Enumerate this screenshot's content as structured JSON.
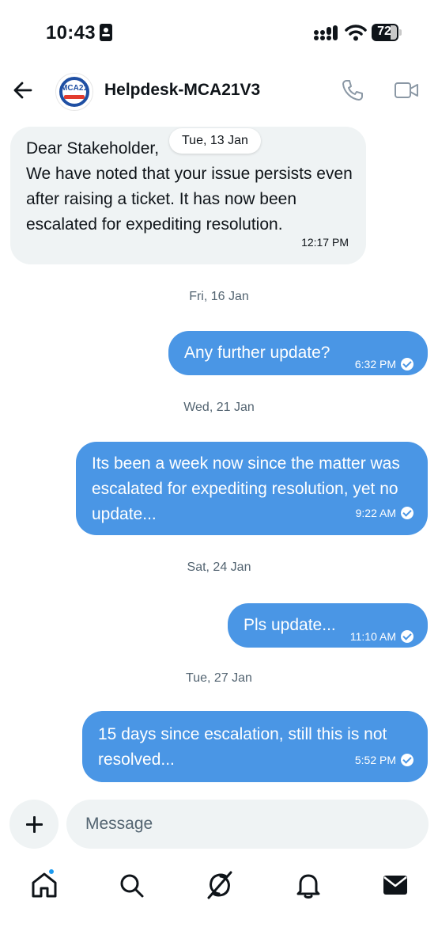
{
  "status_bar": {
    "time": "10:43",
    "battery": "72"
  },
  "header": {
    "contact_name": "Helpdesk-MCA21V3",
    "avatar_text": "MCA21"
  },
  "floating_date": "Tue, 13 Jan",
  "messages": [
    {
      "direction": "incoming",
      "text": "Dear Stakeholder,\nWe have noted that your issue persists even after raising a ticket. It has now been escalated for expediting resolution.",
      "time": "12:17 PM"
    },
    {
      "date_separator": "Fri, 16 Jan"
    },
    {
      "direction": "outgoing",
      "text": "Any further update?",
      "time": "6:32 PM"
    },
    {
      "date_separator": "Wed, 21 Jan"
    },
    {
      "direction": "outgoing",
      "text": "Its been a week now since the matter was escalated for expediting resolution, yet no update...",
      "time": "9:22 AM"
    },
    {
      "date_separator": "Sat, 24 Jan"
    },
    {
      "direction": "outgoing",
      "text": "Pls update...",
      "time": "11:10 AM"
    },
    {
      "date_separator": "Tue, 27 Jan"
    },
    {
      "direction": "outgoing",
      "text": "15 days since escalation, still this is not resolved...",
      "time": "5:52 PM"
    }
  ],
  "composer": {
    "placeholder": "Message"
  },
  "nav": {
    "items": [
      "home-icon",
      "search-icon",
      "grok-icon",
      "notifications-icon",
      "messages-icon"
    ]
  },
  "colors": {
    "outgoing_bubble": "#4a96e5",
    "incoming_bubble": "#eff3f4",
    "accent": "#1d9bf0"
  }
}
